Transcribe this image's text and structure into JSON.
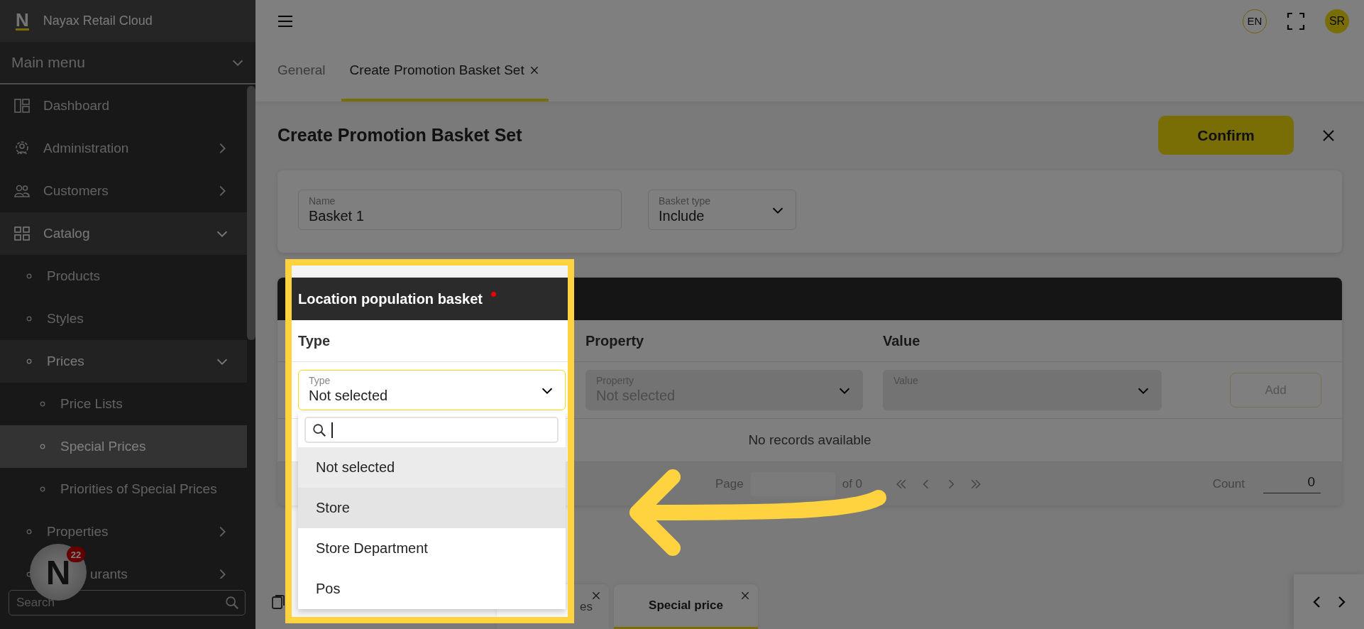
{
  "sidebar": {
    "brand": {
      "logo": "N",
      "name": "Nayax Retail Cloud"
    },
    "menu_title": "Main menu",
    "items": [
      {
        "label": "Dashboard",
        "selected": false
      },
      {
        "label": "Administration",
        "selected": false,
        "expanded": false
      },
      {
        "label": "Customers",
        "selected": false,
        "expanded": false
      },
      {
        "label": "Catalog",
        "selected": false,
        "expanded": true,
        "children": [
          {
            "label": "Products",
            "selected": false
          },
          {
            "label": "Styles",
            "selected": false
          },
          {
            "label": "Prices",
            "selected": false,
            "expanded": true,
            "children": [
              {
                "label": "Price Lists",
                "selected": false
              },
              {
                "label": "Special Prices",
                "selected": true
              },
              {
                "label": "Priorities of Special Prices",
                "selected": false
              }
            ]
          },
          {
            "label": "Properties",
            "selected": false,
            "expanded": false
          },
          {
            "label": "urants",
            "selected": false,
            "expanded": false
          }
        ]
      }
    ],
    "search": {
      "placeholder": "Search"
    }
  },
  "topbar": {
    "language": "EN",
    "user_initials": "SR"
  },
  "tabs": [
    {
      "label": "General",
      "selected": false,
      "closable": false
    },
    {
      "label": "Create Promotion Basket Set",
      "selected": true,
      "closable": true
    }
  ],
  "page": {
    "title": "Create Promotion Basket Set",
    "confirm": "Confirm"
  },
  "form": {
    "fields": [
      {
        "kind": "text",
        "label": "Name",
        "value": "Basket 1"
      },
      {
        "kind": "select",
        "label": "Basket type",
        "value": "Include"
      }
    ]
  },
  "basket": {
    "title": "Location population basket",
    "required": true,
    "columns": [
      "Type",
      "Property",
      "Value"
    ],
    "selects": [
      {
        "label": "Type",
        "value": "Not selected",
        "disabled": false,
        "open": true,
        "options": [
          {
            "label": "Not selected",
            "selected": true,
            "hovered": false
          },
          {
            "label": "Store",
            "selected": false,
            "hovered": true
          },
          {
            "label": "Store Department",
            "selected": false,
            "hovered": false
          },
          {
            "label": "Pos",
            "selected": false,
            "hovered": false
          }
        ]
      },
      {
        "label": "Property",
        "value": "Not selected",
        "disabled": true,
        "open": false
      },
      {
        "label": "Value",
        "disabled": true,
        "open": false
      }
    ],
    "add": {
      "label": "Add",
      "disabled": true
    },
    "empty_text": "No records available",
    "pagination": {
      "page_label": "Page",
      "of": "of 0",
      "count_label": "Count",
      "count": "0"
    }
  },
  "bottom_tabs": [
    {
      "label": "es",
      "selected": false
    },
    {
      "label": "Special price",
      "selected": true
    }
  ],
  "chat": {
    "logo": "N",
    "badge": "22"
  }
}
